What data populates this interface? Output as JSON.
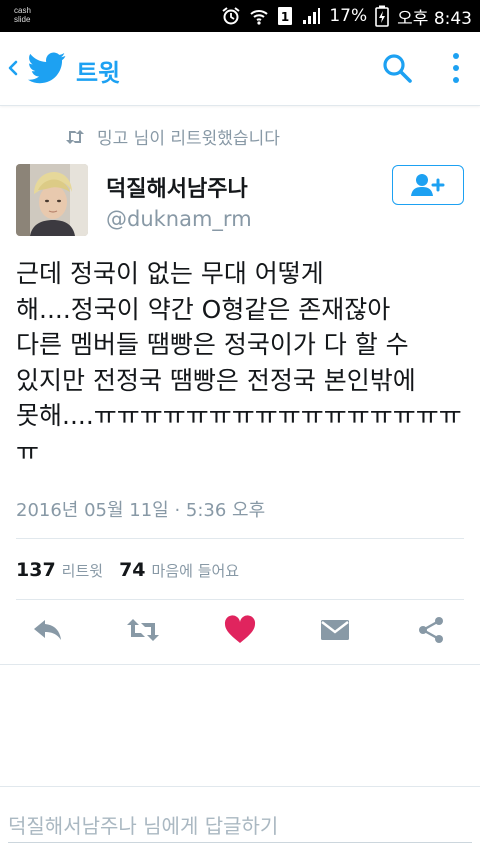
{
  "status_bar": {
    "brand": "cash\nslide",
    "battery": "17%",
    "time": "오후 8:43"
  },
  "header": {
    "title": "트윗",
    "icons": [
      "back-icon",
      "twitter-bird-icon",
      "search-icon",
      "more-vertical-icon"
    ]
  },
  "retweet_context": "밍고 님이 리트윗했습니다",
  "author": {
    "name": "덕질해서남주나",
    "handle": "@duknam_rm"
  },
  "tweet": {
    "lines": [
      "근데 정국이 없는 무대 어떻게",
      "해....정국이 약간 O형같은 존재잖아",
      "다른 멤버들 땜빵은 정국이가 다 할 수",
      "있지만 전정국 땜빵은 전정국 본인밖에",
      "못해....ㅠㅠㅠㅠㅠㅠㅠㅠㅠㅠㅠㅠㅠㅠㅠㅠ",
      "ㅠ"
    ],
    "timestamp": "2016년 05월 11일 · 5:36 오후"
  },
  "stats": {
    "retweets_count": "137",
    "retweets_label": "리트윗",
    "likes_count": "74",
    "likes_label": "마음에 들어요"
  },
  "actions": [
    "reply-icon",
    "retweet-icon",
    "heart-icon",
    "message-icon",
    "share-icon"
  ],
  "colors": {
    "accent": "#1da1f2",
    "like": "#e0245e",
    "muted": "#8899a6",
    "icon": "#8899a6"
  },
  "reply": {
    "placeholder": "덕질해서남주나 님에게 답글하기"
  }
}
